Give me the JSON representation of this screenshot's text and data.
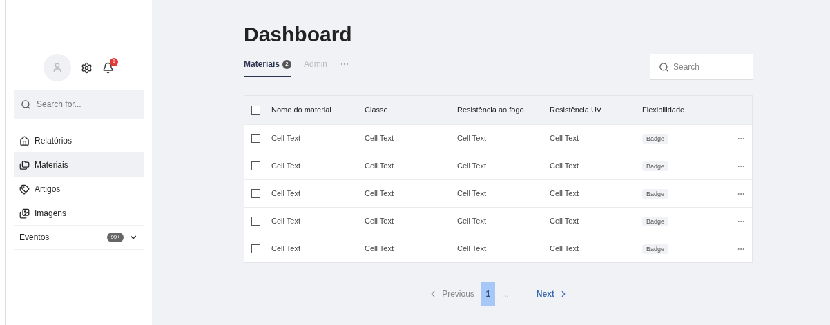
{
  "sidebar": {
    "notification_count": "1",
    "search": {
      "placeholder": "Search for..."
    },
    "items": [
      {
        "kind": "home",
        "label": "Relatórios",
        "selected": false
      },
      {
        "kind": "folder",
        "label": "Materiais",
        "selected": true
      },
      {
        "kind": "tag",
        "label": "Artigos",
        "selected": false
      },
      {
        "kind": "images",
        "label": "Imagens",
        "selected": false
      },
      {
        "kind": "group",
        "label": "Eventos",
        "selected": false,
        "badge": "99+",
        "expanded": false
      }
    ]
  },
  "title": "Dashboard",
  "tabs": [
    {
      "label": "Materiais",
      "count": "2",
      "selected": true
    },
    {
      "label": "Admin",
      "selected": false
    }
  ],
  "search": {
    "placeholder": "Search"
  },
  "table": {
    "columns": [
      "Nome do material",
      "Classe",
      "Resistência ao fogo",
      "Resistência UV",
      "Flexibilidade"
    ],
    "header_checked": false,
    "rows": [
      {
        "checked": false,
        "cells": [
          "Cell Text",
          "Cell Text",
          "Cell Text",
          "Cell Text"
        ],
        "badge": "Badge"
      },
      {
        "checked": false,
        "cells": [
          "Cell Text",
          "Cell Text",
          "Cell Text",
          "Cell Text"
        ],
        "badge": "Badge"
      },
      {
        "checked": false,
        "cells": [
          "Cell Text",
          "Cell Text",
          "Cell Text",
          "Cell Text"
        ],
        "badge": "Badge"
      },
      {
        "checked": false,
        "cells": [
          "Cell Text",
          "Cell Text",
          "Cell Text",
          "Cell Text"
        ],
        "badge": "Badge"
      },
      {
        "checked": false,
        "cells": [
          "Cell Text",
          "Cell Text",
          "Cell Text",
          "Cell Text"
        ],
        "badge": "Badge"
      }
    ]
  },
  "pagination": {
    "previous": "Previous",
    "pages": [
      {
        "label": "1",
        "selected": true
      }
    ],
    "ellipsis": "...",
    "next": "Next"
  }
}
